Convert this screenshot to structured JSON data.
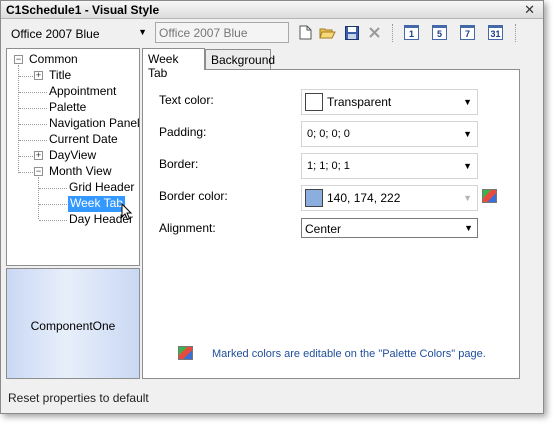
{
  "window": {
    "title": "C1Schedule1 - Visual Style",
    "close_glyph": "✕"
  },
  "toolbar": {
    "style_value": "Office 2007 Blue",
    "style_name_value": "Office 2007 Blue",
    "icons": [
      "new-document-icon",
      "open-folder-icon",
      "save-icon",
      "delete-icon"
    ],
    "calendar_views": [
      "1",
      "5",
      "7",
      "31"
    ]
  },
  "tree": {
    "root": "Common",
    "items": [
      {
        "label": "Title",
        "expandable": true
      },
      {
        "label": "Appointment",
        "expandable": false
      },
      {
        "label": "Palette",
        "expandable": false
      },
      {
        "label": "Navigation Panel",
        "expandable": false
      },
      {
        "label": "Current Date",
        "expandable": false
      },
      {
        "label": "DayView",
        "expandable": true
      },
      {
        "label": "Month View",
        "expandable": true,
        "expanded": true
      }
    ],
    "children": [
      {
        "label": "Grid Header",
        "selected": false
      },
      {
        "label": "Week Tab",
        "selected": true
      },
      {
        "label": "Day Header",
        "selected": false
      }
    ]
  },
  "preview": {
    "label": "ComponentOne"
  },
  "tabs": [
    {
      "label": "Week Tab",
      "active": true
    },
    {
      "label": "Background",
      "active": false
    }
  ],
  "properties": {
    "text_color": {
      "label": "Text color:",
      "value": "Transparent",
      "swatch": "#ffffff"
    },
    "padding": {
      "label": "Padding:",
      "value": "0; 0; 0; 0"
    },
    "border": {
      "label": "Border:",
      "value": "1; 1; 0; 1"
    },
    "border_color": {
      "label": "Border color:",
      "value": "140, 174, 222",
      "swatch": "#8caede"
    },
    "alignment": {
      "label": "Alignment:",
      "value": "Center"
    }
  },
  "note": "Marked colors are editable on the \"Palette Colors\" page.",
  "status": "Reset properties to default",
  "colors": {
    "selection": "#3399ff",
    "note_text": "#1f4e9a",
    "preview_gradient": "#c9d8f3"
  }
}
